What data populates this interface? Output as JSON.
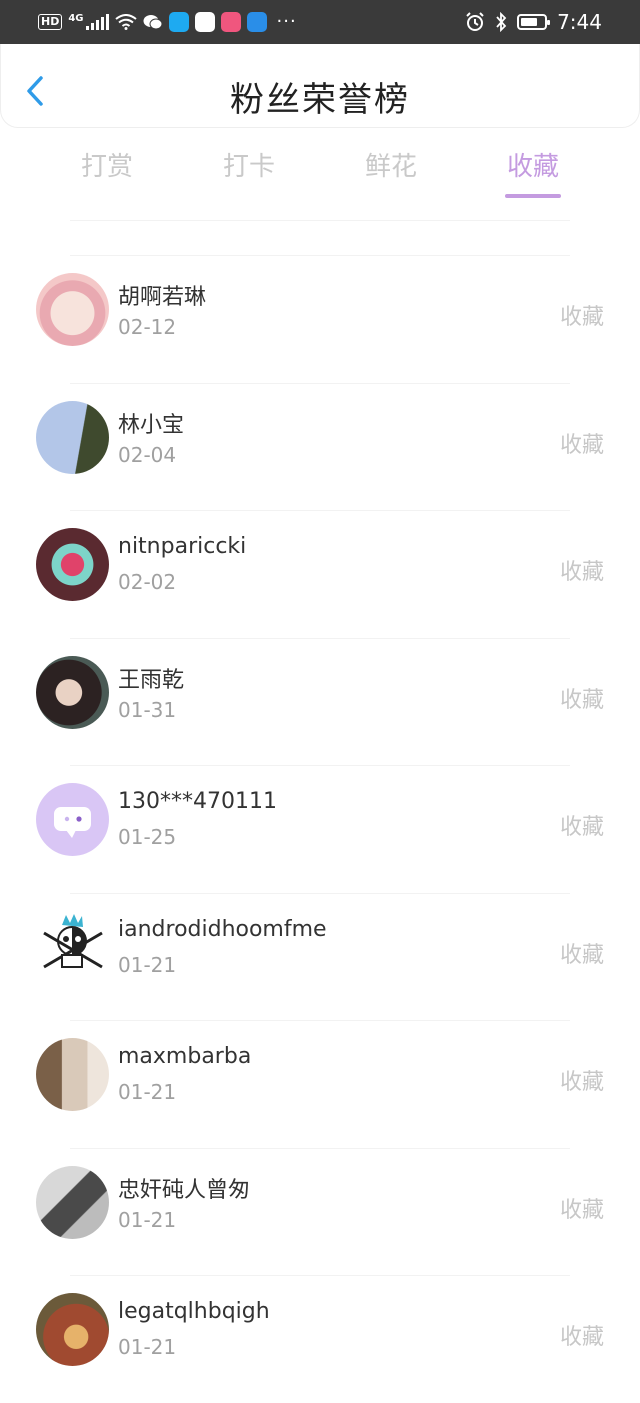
{
  "status_bar": {
    "hd": "HD",
    "network": "4G",
    "time": "7:44",
    "icons": [
      "signal-icon",
      "wifi-icon",
      "wechat-icon",
      "search-app-icon",
      "mall-app-icon",
      "shop-app-icon",
      "weather-app-icon",
      "more-icon",
      "alarm-icon",
      "bluetooth-icon",
      "battery-icon"
    ]
  },
  "header": {
    "title": "粉丝荣誉榜",
    "back_icon": "chevron-left-icon"
  },
  "tabs": [
    {
      "label": "打赏",
      "active": false
    },
    {
      "label": "打卡",
      "active": false
    },
    {
      "label": "鲜花",
      "active": false
    },
    {
      "label": "收藏",
      "active": true
    }
  ],
  "colors": {
    "accent": "#c49be0",
    "status_bar": "#3a3a3a",
    "back_icon": "#2f9be8"
  },
  "fans": [
    {
      "name": "胡啊若琳",
      "date": "02-12",
      "action": "收藏",
      "avatar_bg": "#f0c9c9"
    },
    {
      "name": "林小宝",
      "date": "02-04",
      "action": "收藏",
      "avatar_bg": "#a9c0e3"
    },
    {
      "name": "nitnpariccki",
      "date": "02-02",
      "action": "收藏",
      "avatar_bg": "#8a3d4a"
    },
    {
      "name": "王雨乾",
      "date": "01-31",
      "action": "收藏",
      "avatar_bg": "#3a3030"
    },
    {
      "name": "130***470111",
      "date": "01-25",
      "action": "收藏",
      "avatar_bg": "#d7c3f4"
    },
    {
      "name": "iandrodidhoomfme",
      "date": "01-21",
      "action": "收藏",
      "avatar_bg": "#ffffff"
    },
    {
      "name": "maxmbarba",
      "date": "01-21",
      "action": "收藏",
      "avatar_bg": "#b9a08a"
    },
    {
      "name": "忠奸砘人曾匆",
      "date": "01-21",
      "action": "收藏",
      "avatar_bg": "#9a9a9a"
    },
    {
      "name": "legatqlhbqigh",
      "date": "01-21",
      "action": "收藏",
      "avatar_bg": "#a0553a"
    }
  ]
}
